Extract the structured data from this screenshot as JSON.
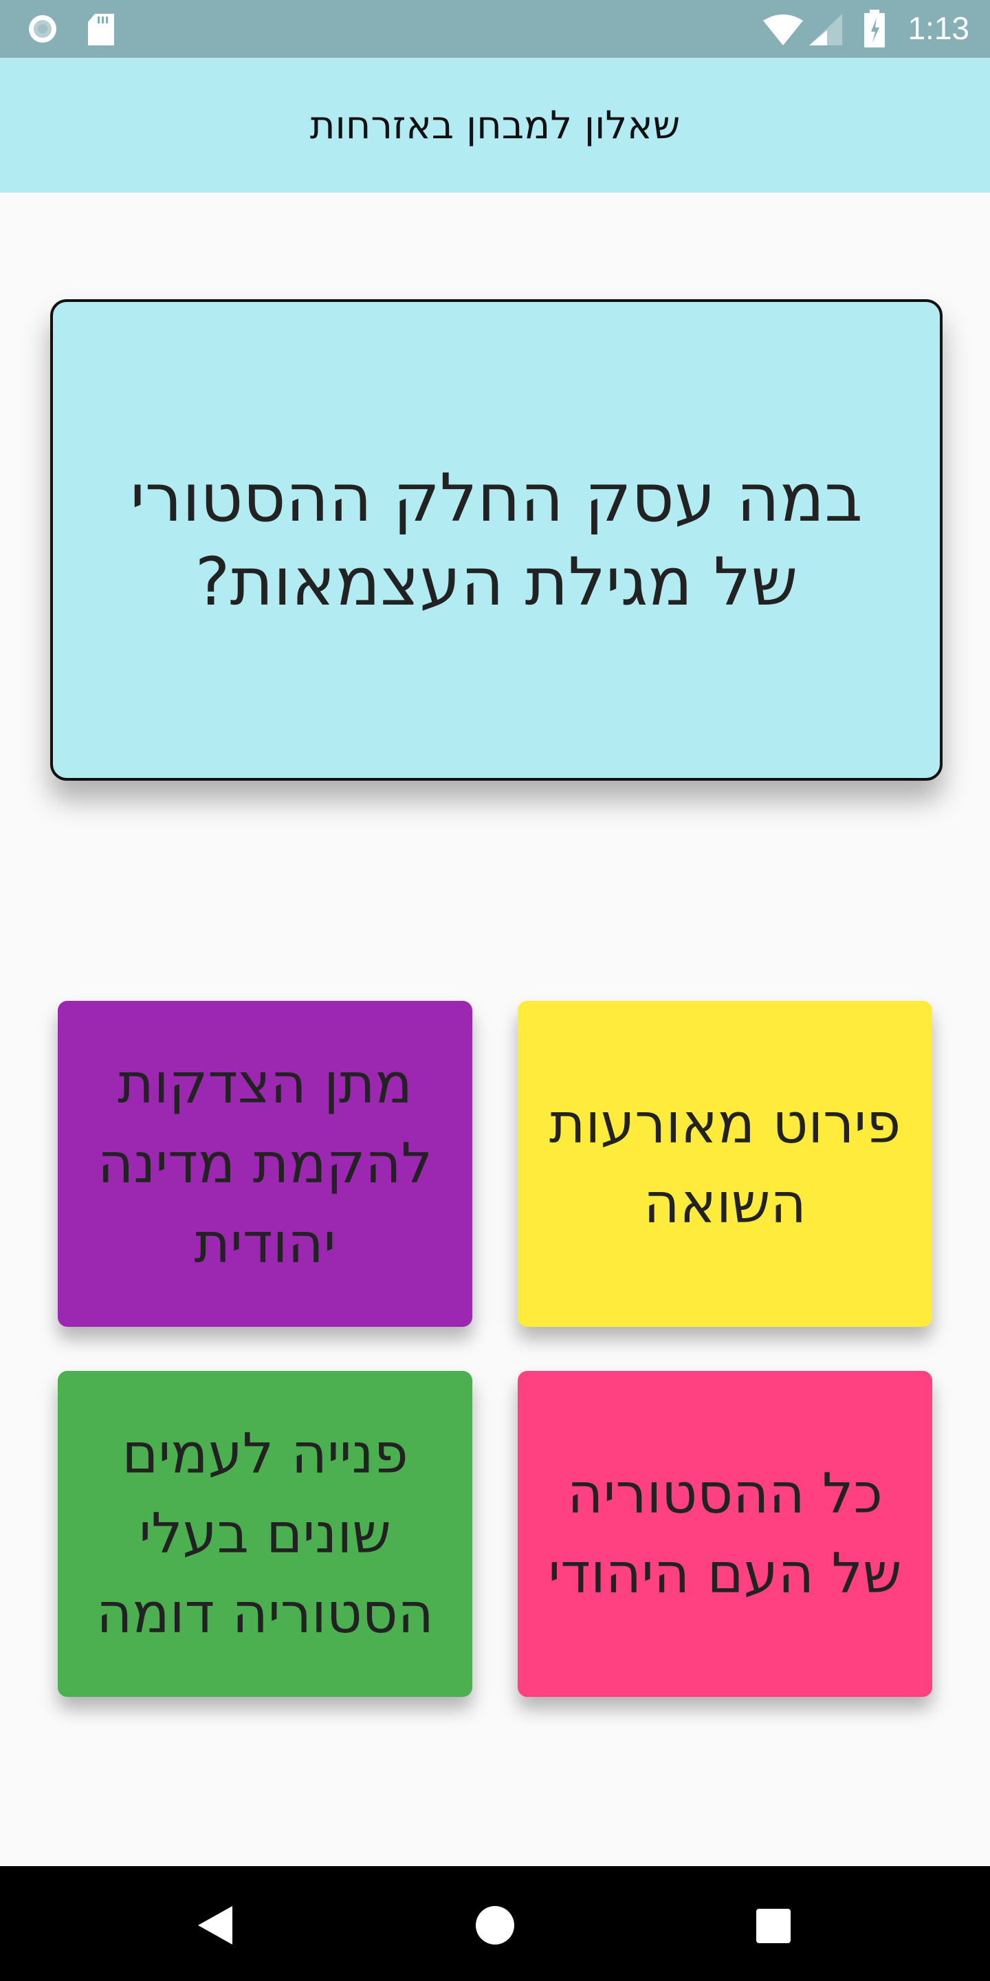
{
  "status_bar": {
    "time": "1:13",
    "icons": [
      "record-icon",
      "sd-card-icon",
      "wifi-icon",
      "signal-icon",
      "battery-charging-icon"
    ]
  },
  "app_bar": {
    "title": "שאלון למבחן באזרחות"
  },
  "question": {
    "text": "במה עסק החלק ההסטורי של מגילת העצמאות?"
  },
  "answers": [
    {
      "text": "פירוט מאורעות השואה",
      "color": "#ffeb3b"
    },
    {
      "text": "מתן הצדקות להקמת מדינה יהודית",
      "color": "#9c27b0"
    },
    {
      "text": "כל ההסטוריה של העם היהודי",
      "color": "#ff4081"
    },
    {
      "text": "פנייה לעמים שונים בעלי הסטוריה דומה",
      "color": "#4caf50"
    }
  ],
  "nav_bar": {
    "icons": [
      "back-icon",
      "home-icon",
      "recents-icon"
    ]
  }
}
